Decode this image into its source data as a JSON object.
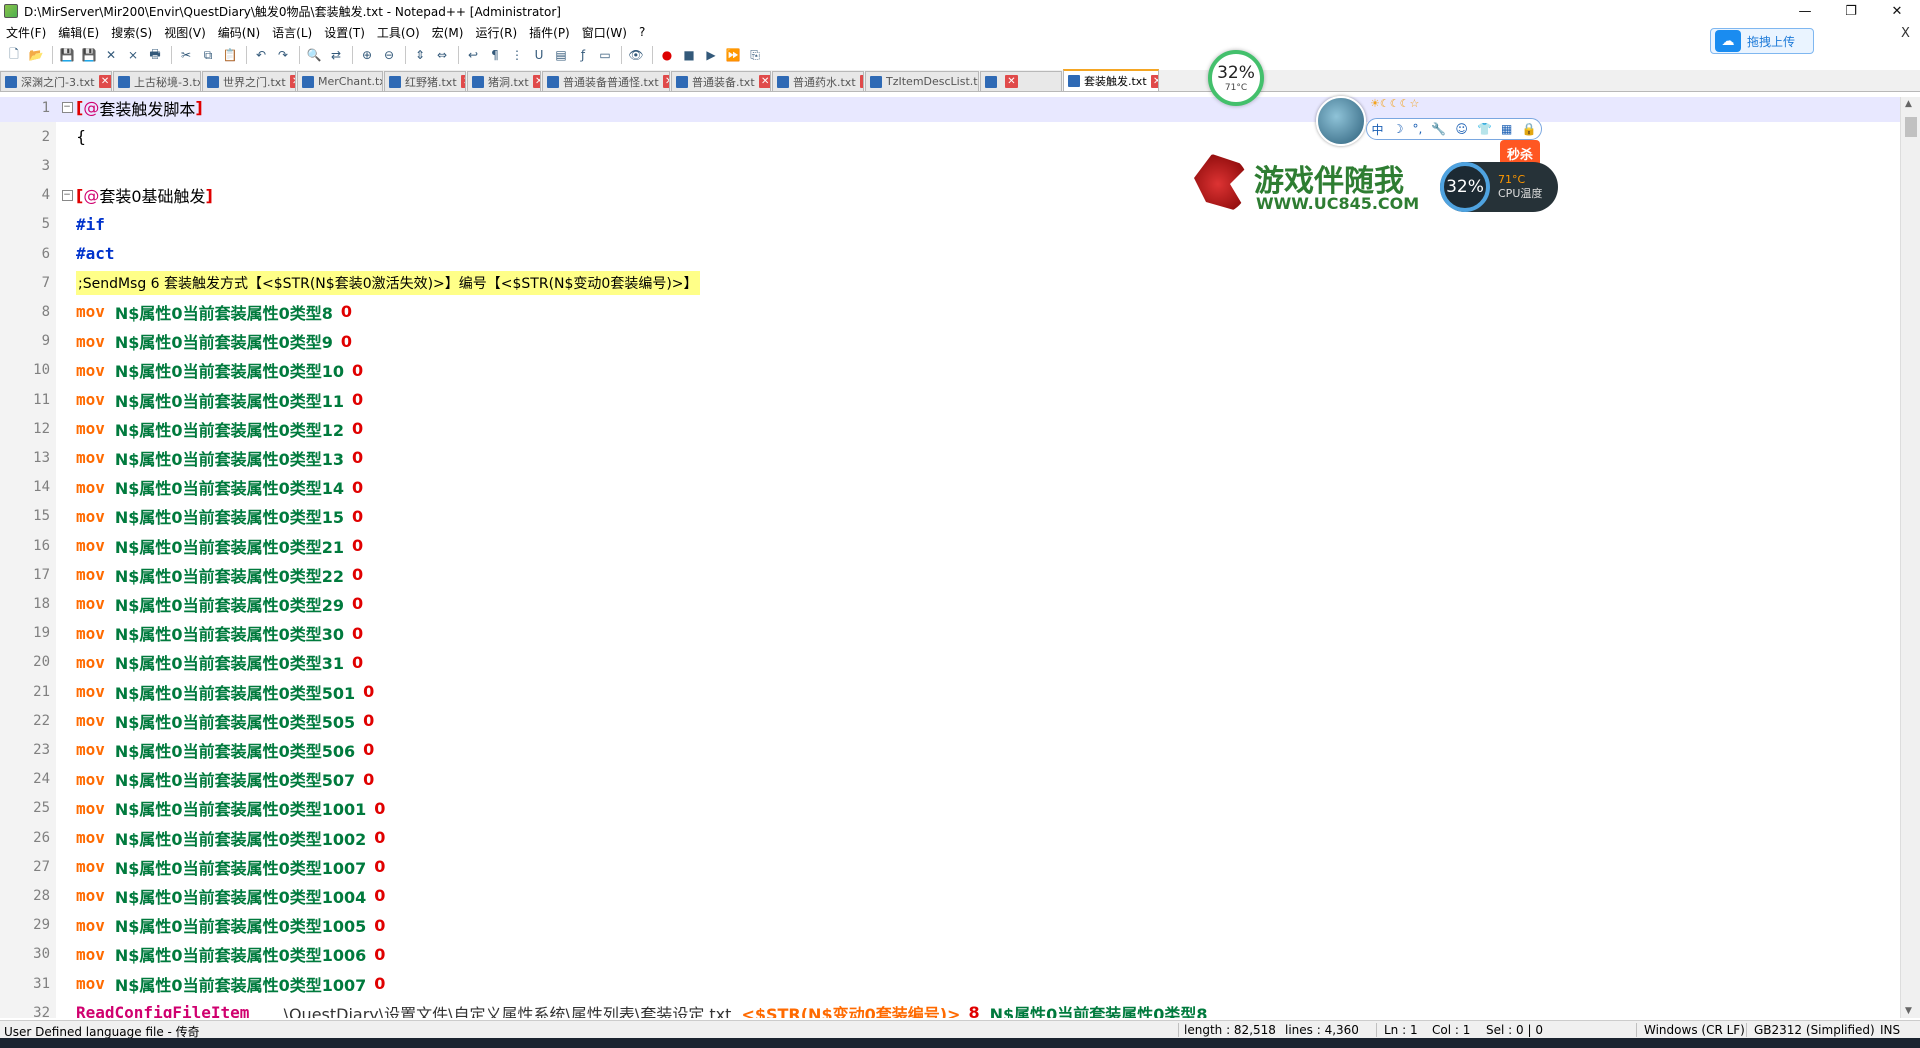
{
  "window": {
    "title": "D:\\MirServer\\Mir200\\Envir\\QuestDiary\\触发0物品\\套装触发.txt - Notepad++ [Administrator]",
    "controls": [
      "—",
      "❐",
      "✕"
    ]
  },
  "menu": {
    "items": [
      "文件(F)",
      "编辑(E)",
      "搜索(S)",
      "视图(V)",
      "编码(N)",
      "语言(L)",
      "设置(T)",
      "工具(O)",
      "宏(M)",
      "运行(R)",
      "插件(P)",
      "窗口(W)",
      "?"
    ],
    "close": "X"
  },
  "toolbar": {
    "icons": [
      "new-file",
      "open-file",
      "save",
      "save-all",
      "close",
      "close-all",
      "print",
      "cut",
      "copy",
      "paste",
      "undo",
      "redo",
      "find",
      "replace",
      "zoom-in",
      "zoom-out",
      "sync-v",
      "sync-h",
      "word-wrap",
      "all-chars",
      "indent-guide",
      "udl",
      "doc-map",
      "function-list",
      "folder-workspace",
      "monitor",
      "record",
      "stop",
      "play",
      "play-multi",
      "save-macro"
    ]
  },
  "cloud_upload": {
    "label": "拖拽上传"
  },
  "tabs": [
    {
      "label": "深渊之门-3.txt",
      "active": false
    },
    {
      "label": "上古秘境-3.txt",
      "active": false
    },
    {
      "label": "世界之门.txt",
      "active": false
    },
    {
      "label": "MerChant.txt",
      "active": false
    },
    {
      "label": "红野猪.txt",
      "active": false
    },
    {
      "label": "猪洞.txt",
      "active": false
    },
    {
      "label": "普通装备普通怪.txt",
      "active": false
    },
    {
      "label": "普通装备.txt",
      "active": false
    },
    {
      "label": "普通药水.txt",
      "active": false
    },
    {
      "label": "TzItemDescList.txt",
      "active": false
    },
    {
      "label": "",
      "active": false
    },
    {
      "label": "套装触发.txt",
      "active": true
    }
  ],
  "editor": {
    "lines": [
      {
        "n": "1",
        "type": "header",
        "text": "套装触发脚本"
      },
      {
        "n": "2",
        "type": "plain",
        "text": "{"
      },
      {
        "n": "3",
        "type": "plain",
        "text": ""
      },
      {
        "n": "4",
        "type": "header",
        "text": "套装0基础触发"
      },
      {
        "n": "5",
        "type": "hash",
        "text": "#if"
      },
      {
        "n": "6",
        "type": "hash",
        "text": "#act"
      },
      {
        "n": "7",
        "type": "comment",
        "text": ";SendMsg 6 套装触发方式【<$STR(N$套装0激活失效)>】编号【<$STR(N$变动0套装编号)>】"
      },
      {
        "n": "8",
        "type": "mov",
        "var": "N$属性0当前套装属性0类型8",
        "val": "0"
      },
      {
        "n": "9",
        "type": "mov",
        "var": "N$属性0当前套装属性0类型9",
        "val": "0"
      },
      {
        "n": "10",
        "type": "mov",
        "var": "N$属性0当前套装属性0类型10",
        "val": "0"
      },
      {
        "n": "11",
        "type": "mov",
        "var": "N$属性0当前套装属性0类型11",
        "val": "0"
      },
      {
        "n": "12",
        "type": "mov",
        "var": "N$属性0当前套装属性0类型12",
        "val": "0"
      },
      {
        "n": "13",
        "type": "mov",
        "var": "N$属性0当前套装属性0类型13",
        "val": "0"
      },
      {
        "n": "14",
        "type": "mov",
        "var": "N$属性0当前套装属性0类型14",
        "val": "0"
      },
      {
        "n": "15",
        "type": "mov",
        "var": "N$属性0当前套装属性0类型15",
        "val": "0"
      },
      {
        "n": "16",
        "type": "mov",
        "var": "N$属性0当前套装属性0类型21",
        "val": "0"
      },
      {
        "n": "17",
        "type": "mov",
        "var": "N$属性0当前套装属性0类型22",
        "val": "0"
      },
      {
        "n": "18",
        "type": "mov",
        "var": "N$属性0当前套装属性0类型29",
        "val": "0"
      },
      {
        "n": "19",
        "type": "mov",
        "var": "N$属性0当前套装属性0类型30",
        "val": "0"
      },
      {
        "n": "20",
        "type": "mov",
        "var": "N$属性0当前套装属性0类型31",
        "val": "0"
      },
      {
        "n": "21",
        "type": "mov",
        "var": "N$属性0当前套装属性0类型501",
        "val": "0"
      },
      {
        "n": "22",
        "type": "mov",
        "var": "N$属性0当前套装属性0类型505",
        "val": "0"
      },
      {
        "n": "23",
        "type": "mov",
        "var": "N$属性0当前套装属性0类型506",
        "val": "0"
      },
      {
        "n": "24",
        "type": "mov",
        "var": "N$属性0当前套装属性0类型507",
        "val": "0"
      },
      {
        "n": "25",
        "type": "mov",
        "var": "N$属性0当前套装属性0类型1001",
        "val": "0"
      },
      {
        "n": "26",
        "type": "mov",
        "var": "N$属性0当前套装属性0类型1002",
        "val": "0"
      },
      {
        "n": "27",
        "type": "mov",
        "var": "N$属性0当前套装属性0类型1007",
        "val": "0"
      },
      {
        "n": "28",
        "type": "mov",
        "var": "N$属性0当前套装属性0类型1004",
        "val": "0"
      },
      {
        "n": "29",
        "type": "mov",
        "var": "N$属性0当前套装属性0类型1005",
        "val": "0"
      },
      {
        "n": "30",
        "type": "mov",
        "var": "N$属性0当前套装属性0类型1006",
        "val": "0"
      },
      {
        "n": "31",
        "type": "mov",
        "var": "N$属性0当前套装属性0类型1007",
        "val": "0"
      },
      {
        "n": "32",
        "type": "read",
        "cmd": "ReadConfigFileItem",
        "path": "..\\QuestDiary\\设置文件\\自定义属性系统\\属性列表\\套装设定.txt",
        "strv": "<$STR(N$变动0套装编号)>",
        "num": "8",
        "var": "N$属性0当前套装属性0类型8"
      }
    ],
    "mov_keyword": "mov",
    "bracket_open": "[",
    "bracket_close": "]",
    "at": "@"
  },
  "status": {
    "lang": "User Defined language file - 传奇",
    "length": "length : 82,518",
    "lines": "lines : 4,360",
    "ln": "Ln : 1",
    "col": "Col : 1",
    "sel": "Sel : 0 | 0",
    "eol": "Windows (CR LF)",
    "encoding": "GB2312 (Simplified)",
    "ins": "INS"
  },
  "overlays": {
    "cpu_pct": "32%",
    "cpu_temp": "71°C",
    "ime_items": [
      "中",
      "☽",
      "°,",
      "🔧",
      "☺",
      "👕",
      "▦",
      "🔒"
    ],
    "weather": "☀☾☾☾☆",
    "game_name": "游戏伴随我",
    "game_url": "WWW.UC845.COM",
    "seckill": "秒杀",
    "cpu2_pct": "32%",
    "cpu2_temp": "71°C",
    "cpu2_label": "CPU温度"
  }
}
